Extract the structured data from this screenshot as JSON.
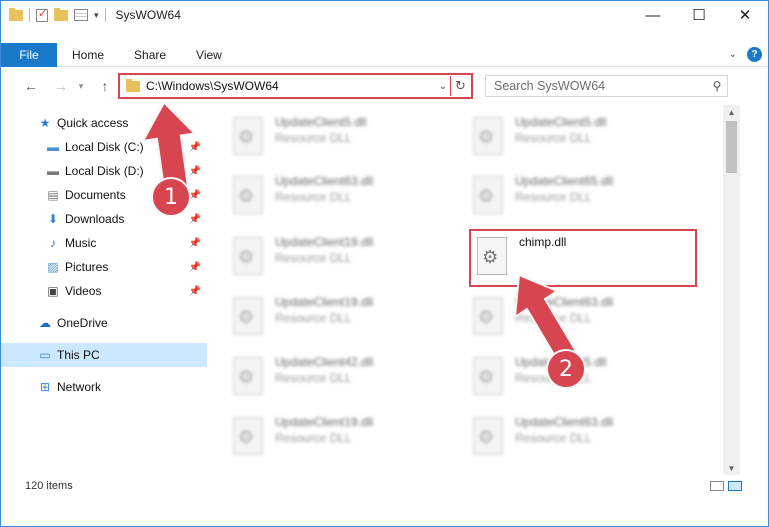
{
  "window": {
    "title": "SysWOW64"
  },
  "ribbon": {
    "tabs": [
      {
        "label": "File"
      },
      {
        "label": "Home"
      },
      {
        "label": "Share"
      },
      {
        "label": "View"
      }
    ],
    "help_label": "?"
  },
  "navbar": {
    "address": "C:\\Windows\\SysWOW64",
    "search_placeholder": "Search SysWOW64"
  },
  "sidebar": {
    "items": [
      {
        "label": "Quick access",
        "icon": "star-icon",
        "pinned": false
      },
      {
        "label": "Local Disk (C:)",
        "icon": "drive-icon",
        "pinned": true
      },
      {
        "label": "Local Disk (D:)",
        "icon": "drive-icon",
        "pinned": true
      },
      {
        "label": "Documents",
        "icon": "document-icon",
        "pinned": true
      },
      {
        "label": "Downloads",
        "icon": "download-icon",
        "pinned": true
      },
      {
        "label": "Music",
        "icon": "music-icon",
        "pinned": true
      },
      {
        "label": "Pictures",
        "icon": "picture-icon",
        "pinned": true
      },
      {
        "label": "Videos",
        "icon": "video-icon",
        "pinned": true
      },
      {
        "label": "OneDrive",
        "icon": "cloud-icon",
        "pinned": false
      },
      {
        "label": "This PC",
        "icon": "computer-icon",
        "pinned": false,
        "selected": true
      },
      {
        "label": "Network",
        "icon": "network-icon",
        "pinned": false
      }
    ]
  },
  "files": [
    {
      "name": "UpdateClient5.dll",
      "type": "Resource DLL"
    },
    {
      "name": "UpdateClient5.dll",
      "type": "Resource DLL"
    },
    {
      "name": "UpdateClient63.dll",
      "type": "Resource DLL"
    },
    {
      "name": "UpdateClient65.dll",
      "type": "Resource DLL"
    },
    {
      "name": "UpdateClient19.dll",
      "type": "Resource DLL"
    },
    {
      "name": "chimp.dll",
      "type": ""
    },
    {
      "name": "UpdateClient19.dll",
      "type": "Resource DLL"
    },
    {
      "name": "UpdateClient63.dll",
      "type": "Resource DLL"
    },
    {
      "name": "UpdateClient42.dll",
      "type": "Resource DLL"
    },
    {
      "name": "UpdateClient5.dll",
      "type": "Resource DLL"
    },
    {
      "name": "UpdateClient19.dll",
      "type": "Resource DLL"
    },
    {
      "name": "UpdateClient63.dll",
      "type": "Resource DLL"
    }
  ],
  "status": {
    "item_count": "120 items"
  },
  "annotations": [
    {
      "label": "1"
    },
    {
      "label": "2"
    }
  ],
  "colors": {
    "accent": "#1979ca",
    "highlight": "#d64550",
    "selected": "#cce8ff"
  }
}
